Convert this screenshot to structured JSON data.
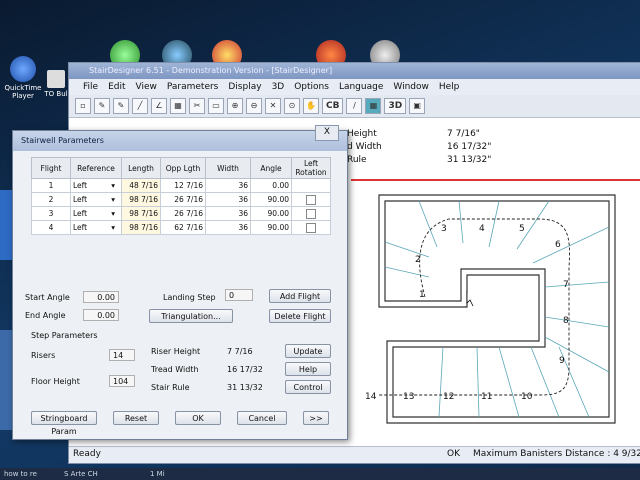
{
  "desktop": {
    "icons": [
      {
        "label": "QuickTime Player"
      },
      {
        "label": "TO Bul"
      }
    ],
    "taskbar_items": [
      "how to re",
      "S Arte CH",
      "1 Mi"
    ]
  },
  "app": {
    "title": "StairDesigner 6.51 - Demonstration Version - [StairDesigner]",
    "menu": [
      "File",
      "Edit",
      "View",
      "Parameters",
      "Display",
      "3D",
      "Options",
      "Language",
      "Window",
      "Help"
    ],
    "toolbar_text": {
      "cb": "CB",
      "three_d": "3D"
    },
    "info": [
      {
        "label": "Height",
        "value": "7 7/16\""
      },
      {
        "label": "d Width",
        "value": "16 17/32\""
      },
      {
        "label": "Rule",
        "value": "31 13/32\""
      }
    ],
    "status": {
      "ready": "Ready",
      "ok": "OK",
      "banisters": "Maximum Banisters Distance : 4 9/32\""
    }
  },
  "dialog": {
    "title": "Stairwell Parameters",
    "close": "X",
    "columns": [
      "Flight",
      "Reference",
      "Length",
      "Opp Lgth",
      "Width",
      "Angle",
      "Left Rotation"
    ],
    "rows": [
      {
        "flight": "1",
        "reference": "Left",
        "length": "48 7/16",
        "opp": "12 7/16",
        "width": "36",
        "angle": "0.00"
      },
      {
        "flight": "2",
        "reference": "Left",
        "length": "98 7/16",
        "opp": "26 7/16",
        "width": "36",
        "angle": "90.00"
      },
      {
        "flight": "3",
        "reference": "Left",
        "length": "98 7/16",
        "opp": "26 7/16",
        "width": "36",
        "angle": "90.00"
      },
      {
        "flight": "4",
        "reference": "Left",
        "length": "98 7/16",
        "opp": "62 7/16",
        "width": "36",
        "angle": "90.00"
      }
    ],
    "start_angle_label": "Start Angle",
    "start_angle": "0.00",
    "end_angle_label": "End Angle",
    "end_angle": "0.00",
    "landing_step_label": "Landing Step",
    "landing_step": "0",
    "add_flight": "Add Flight",
    "delete_flight": "Delete Flight",
    "triangulation": "Triangulation...",
    "step_params_label": "Step Parameters",
    "risers_label": "Risers",
    "risers": "14",
    "floor_height_label": "Floor Height",
    "floor_height": "104",
    "riser_height_label": "Riser Height",
    "riser_height": "7 7/16",
    "tread_width_label": "Tread Width",
    "tread_width": "16 17/32",
    "stair_rule_label": "Stair Rule",
    "stair_rule": "31 13/32",
    "update": "Update",
    "help": "Help",
    "control": "Control",
    "stringboard": "Stringboard Param",
    "reset": "Reset",
    "ok": "OK",
    "cancel": "Cancel",
    "more": ">>"
  },
  "drawing": {
    "step_labels": [
      "1",
      "2",
      "3",
      "4",
      "5",
      "6",
      "7",
      "8",
      "9",
      "10",
      "11",
      "12",
      "13",
      "14"
    ]
  }
}
